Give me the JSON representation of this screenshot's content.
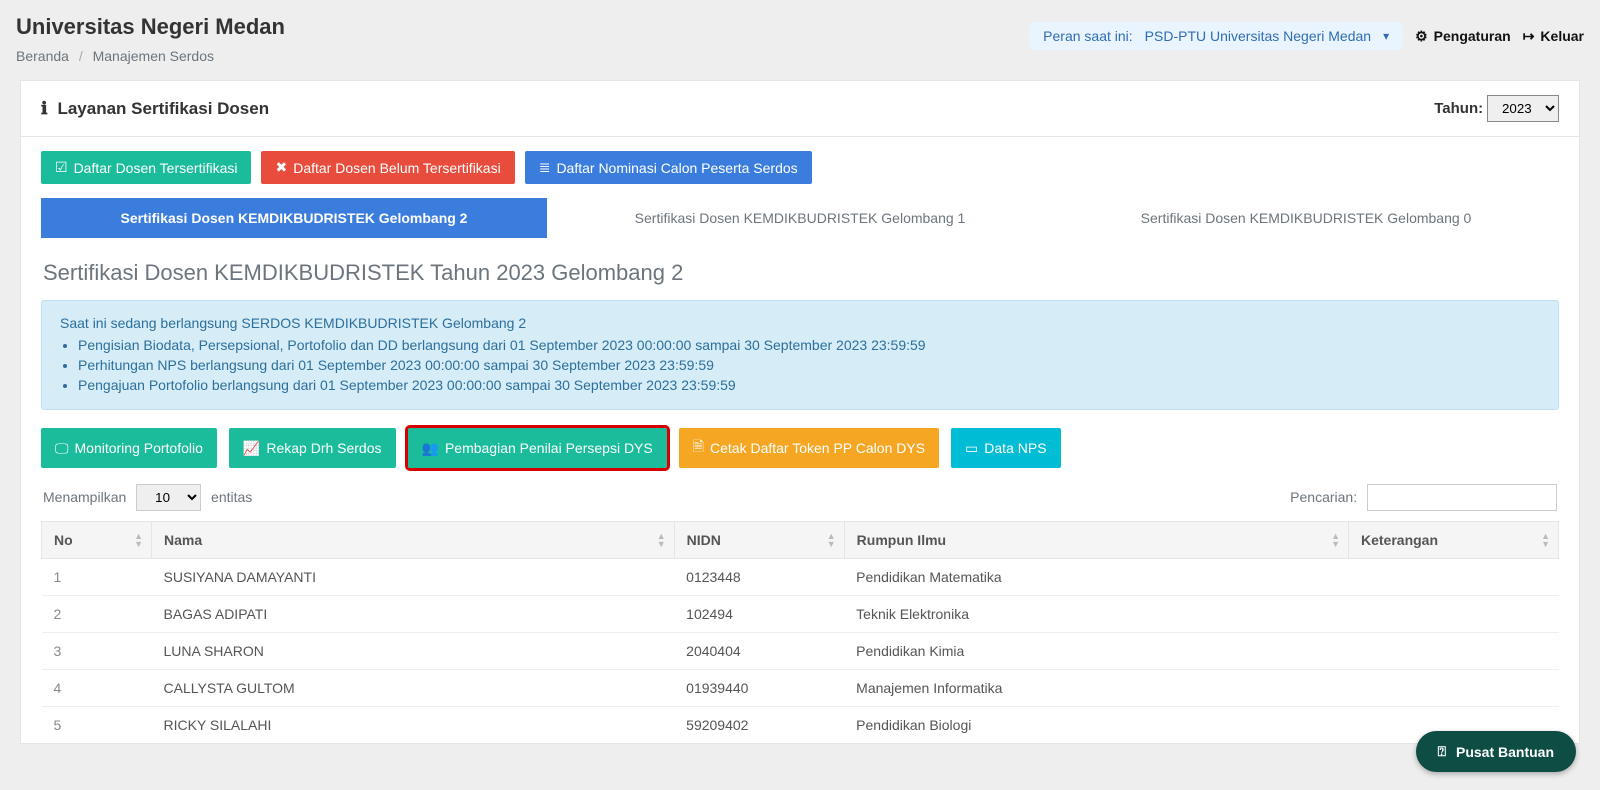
{
  "brand": "Universitas Negeri Medan",
  "breadcrumb": {
    "home": "Beranda",
    "current": "Manajemen Serdos"
  },
  "topbar": {
    "role_label": "Peran saat ini:",
    "role_value": "PSD-PTU Universitas Negeri Medan",
    "settings": "Pengaturan",
    "logout": "Keluar"
  },
  "card": {
    "title": "Layanan Sertifikasi Dosen",
    "year_label": "Tahun:",
    "year_value": "2023"
  },
  "primary_buttons": {
    "certified": "Daftar Dosen Tersertifikasi",
    "uncertified": "Daftar Dosen Belum Tersertifikasi",
    "nomination": "Daftar Nominasi Calon Peserta Serdos"
  },
  "tabs": [
    {
      "label": "Sertifikasi Dosen KEMDIKBUDRISTEK Gelombang 2",
      "active": true
    },
    {
      "label": "Sertifikasi Dosen KEMDIKBUDRISTEK Gelombang 1",
      "active": false
    },
    {
      "label": "Sertifikasi Dosen KEMDIKBUDRISTEK Gelombang 0",
      "active": false
    }
  ],
  "section_heading": "Sertifikasi Dosen KEMDIKBUDRISTEK Tahun 2023 Gelombang 2",
  "info_alert": {
    "headline": "Saat ini sedang berlangsung SERDOS KEMDIKBUDRISTEK Gelombang 2",
    "items": [
      "Pengisian Biodata, Persepsional, Portofolio dan DD berlangsung dari 01 September 2023 00:00:00 sampai 30 September 2023 23:59:59",
      "Perhitungan NPS berlangsung dari 01 September 2023 00:00:00 sampai 30 September 2023 23:59:59",
      "Pengajuan Portofolio berlangsung dari 01 September 2023 00:00:00 sampai 30 September 2023 23:59:59"
    ]
  },
  "action_buttons": {
    "monitoring": "Monitoring Portofolio",
    "rekap": "Rekap Drh Serdos",
    "pembagian": "Pembagian Penilai Persepsi DYS",
    "cetak": "Cetak Daftar Token PP Calon DYS",
    "nps": "Data NPS"
  },
  "datatable": {
    "show_prefix": "Menampilkan",
    "show_suffix": "entitas",
    "page_length": "10",
    "search_label": "Pencarian:",
    "columns": [
      "No",
      "Nama",
      "NIDN",
      "Rumpun Ilmu",
      "Keterangan"
    ],
    "rows": [
      {
        "no": "1",
        "nama": "SUSIYANA DAMAYANTI",
        "nidn": "0123448",
        "rumpun": "Pendidikan Matematika",
        "ket": ""
      },
      {
        "no": "2",
        "nama": "BAGAS ADIPATI",
        "nidn": "102494",
        "rumpun": "Teknik Elektronika",
        "ket": ""
      },
      {
        "no": "3",
        "nama": "LUNA SHARON",
        "nidn": "2040404",
        "rumpun": "Pendidikan Kimia",
        "ket": ""
      },
      {
        "no": "4",
        "nama": "CALLYSTA GULTOM",
        "nidn": "01939440",
        "rumpun": "Manajemen Informatika",
        "ket": ""
      },
      {
        "no": "5",
        "nama": "RICKY SILALAHI",
        "nidn": "59209402",
        "rumpun": "Pendidikan Biologi",
        "ket": ""
      }
    ]
  },
  "help_center": "Pusat Bantuan"
}
